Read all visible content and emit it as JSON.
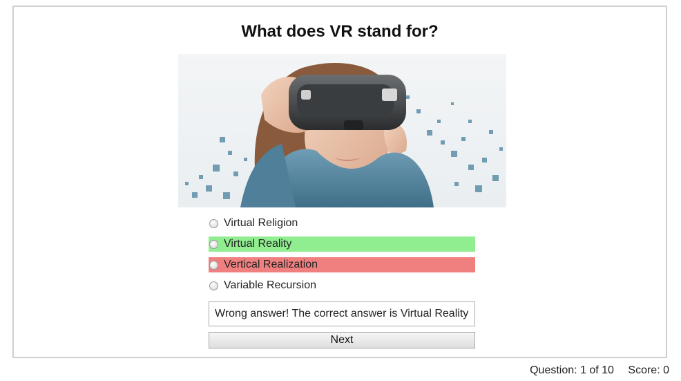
{
  "quiz": {
    "question": "What does VR stand for?",
    "image": {
      "icon": "vr-headset-photo",
      "alt": ""
    },
    "options": [
      {
        "label": "Virtual Religion",
        "state": "none"
      },
      {
        "label": "Virtual Reality",
        "state": "correct"
      },
      {
        "label": "Vertical Realization",
        "state": "wrong"
      },
      {
        "label": "Variable Recursion",
        "state": "none"
      }
    ],
    "feedback": "Wrong answer! The correct answer is Virtual Reality",
    "next_label": "Next",
    "colors": {
      "correct": "#90ee90",
      "wrong": "#f08080"
    }
  },
  "status": {
    "question_progress": "Question: 1 of 10",
    "score": "Score: 0"
  }
}
